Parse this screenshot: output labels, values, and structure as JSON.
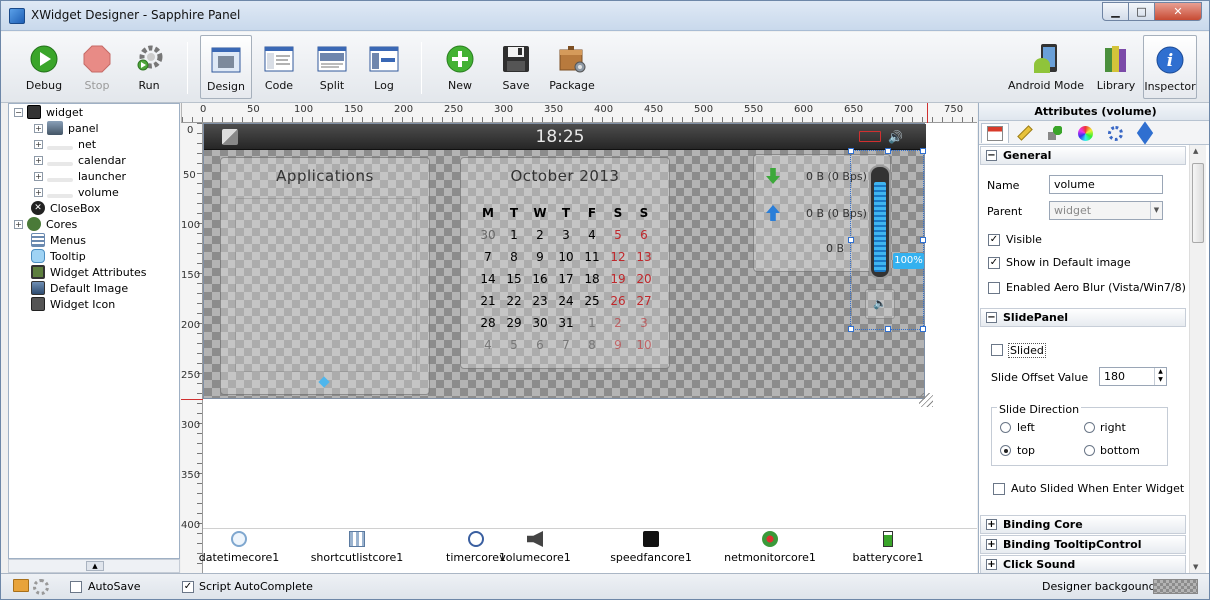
{
  "window": {
    "title": "XWidget Designer - Sapphire Panel",
    "minimize": "▁",
    "maximize": "□",
    "close": "✕"
  },
  "toolbar": {
    "debug": "Debug",
    "stop": "Stop",
    "run": "Run",
    "design": "Design",
    "code": "Code",
    "split": "Split",
    "log": "Log",
    "new": "New",
    "save": "Save",
    "package": "Package",
    "android_mode": "Android Mode",
    "library": "Library",
    "inspector": "Inspector"
  },
  "tree": {
    "items": [
      {
        "label": "widget"
      },
      {
        "label": "panel"
      },
      {
        "label": "net"
      },
      {
        "label": "calendar"
      },
      {
        "label": "launcher"
      },
      {
        "label": "volume"
      },
      {
        "label": "CloseBox"
      },
      {
        "label": "Cores"
      },
      {
        "label": "Menus"
      },
      {
        "label": "Tooltip"
      },
      {
        "label": "Widget Attributes"
      },
      {
        "label": "Default Image"
      },
      {
        "label": "Widget Icon"
      }
    ]
  },
  "ruler": {
    "h": [
      "0",
      "50",
      "100",
      "150",
      "200",
      "250",
      "300",
      "350",
      "400",
      "450",
      "500",
      "550",
      "600",
      "650",
      "700",
      "750"
    ],
    "v": [
      "0",
      "50",
      "100",
      "150",
      "200",
      "250",
      "300",
      "350",
      "400"
    ]
  },
  "widget": {
    "clock": "18:25",
    "applications_title": "Applications",
    "calendar_title": "October 2013",
    "weekdays": [
      "M",
      "T",
      "W",
      "T",
      "F",
      "S",
      "S"
    ],
    "weeks": [
      [
        "30",
        "1",
        "2",
        "3",
        "4",
        "5",
        "6"
      ],
      [
        "7",
        "8",
        "9",
        "10",
        "11",
        "12",
        "13"
      ],
      [
        "14",
        "15",
        "16",
        "17",
        "18",
        "19",
        "20"
      ],
      [
        "21",
        "22",
        "23",
        "24",
        "25",
        "26",
        "27"
      ],
      [
        "28",
        "29",
        "30",
        "31",
        "1",
        "2",
        "3"
      ],
      [
        "4",
        "5",
        "6",
        "7",
        "8",
        "9",
        "10"
      ]
    ],
    "net_down": "0 B (0 Bps)",
    "net_up": "0 B (0 Bps)",
    "net_total": "0 B",
    "volume_percent": "100%",
    "volume_level": 1.0
  },
  "cores": [
    {
      "label": "datetimecore1"
    },
    {
      "label": "shortcutlistcore1"
    },
    {
      "label": "timercore1"
    },
    {
      "label": "volumecore1"
    },
    {
      "label": "speedfancore1"
    },
    {
      "label": "netmonitorcore1"
    },
    {
      "label": "batterycore1"
    }
  ],
  "inspector": {
    "title": "Attributes (volume)",
    "general": {
      "header": "General",
      "name_label": "Name",
      "name_value": "volume",
      "parent_label": "Parent",
      "parent_value": "widget",
      "visible": "Visible",
      "show_default": "Show in Default image",
      "aero_blur": "Enabled Aero Blur (Vista/Win7/8)"
    },
    "slide": {
      "header": "SlidePanel",
      "slided": "Slided",
      "offset_label": "Slide Offset Value",
      "offset_value": "180",
      "direction_label": "Slide Direction",
      "left": "left",
      "right": "right",
      "top": "top",
      "bottom": "bottom",
      "auto_slided": "Auto Slided When Enter Widget"
    },
    "binding_core": "Binding Core",
    "binding_tooltip": "Binding TooltipControl",
    "click_sound": "Click Sound"
  },
  "bottombar": {
    "autosave": "AutoSave",
    "script_autocomplete": "Script AutoComplete",
    "designer_background": "Designer backgound"
  }
}
